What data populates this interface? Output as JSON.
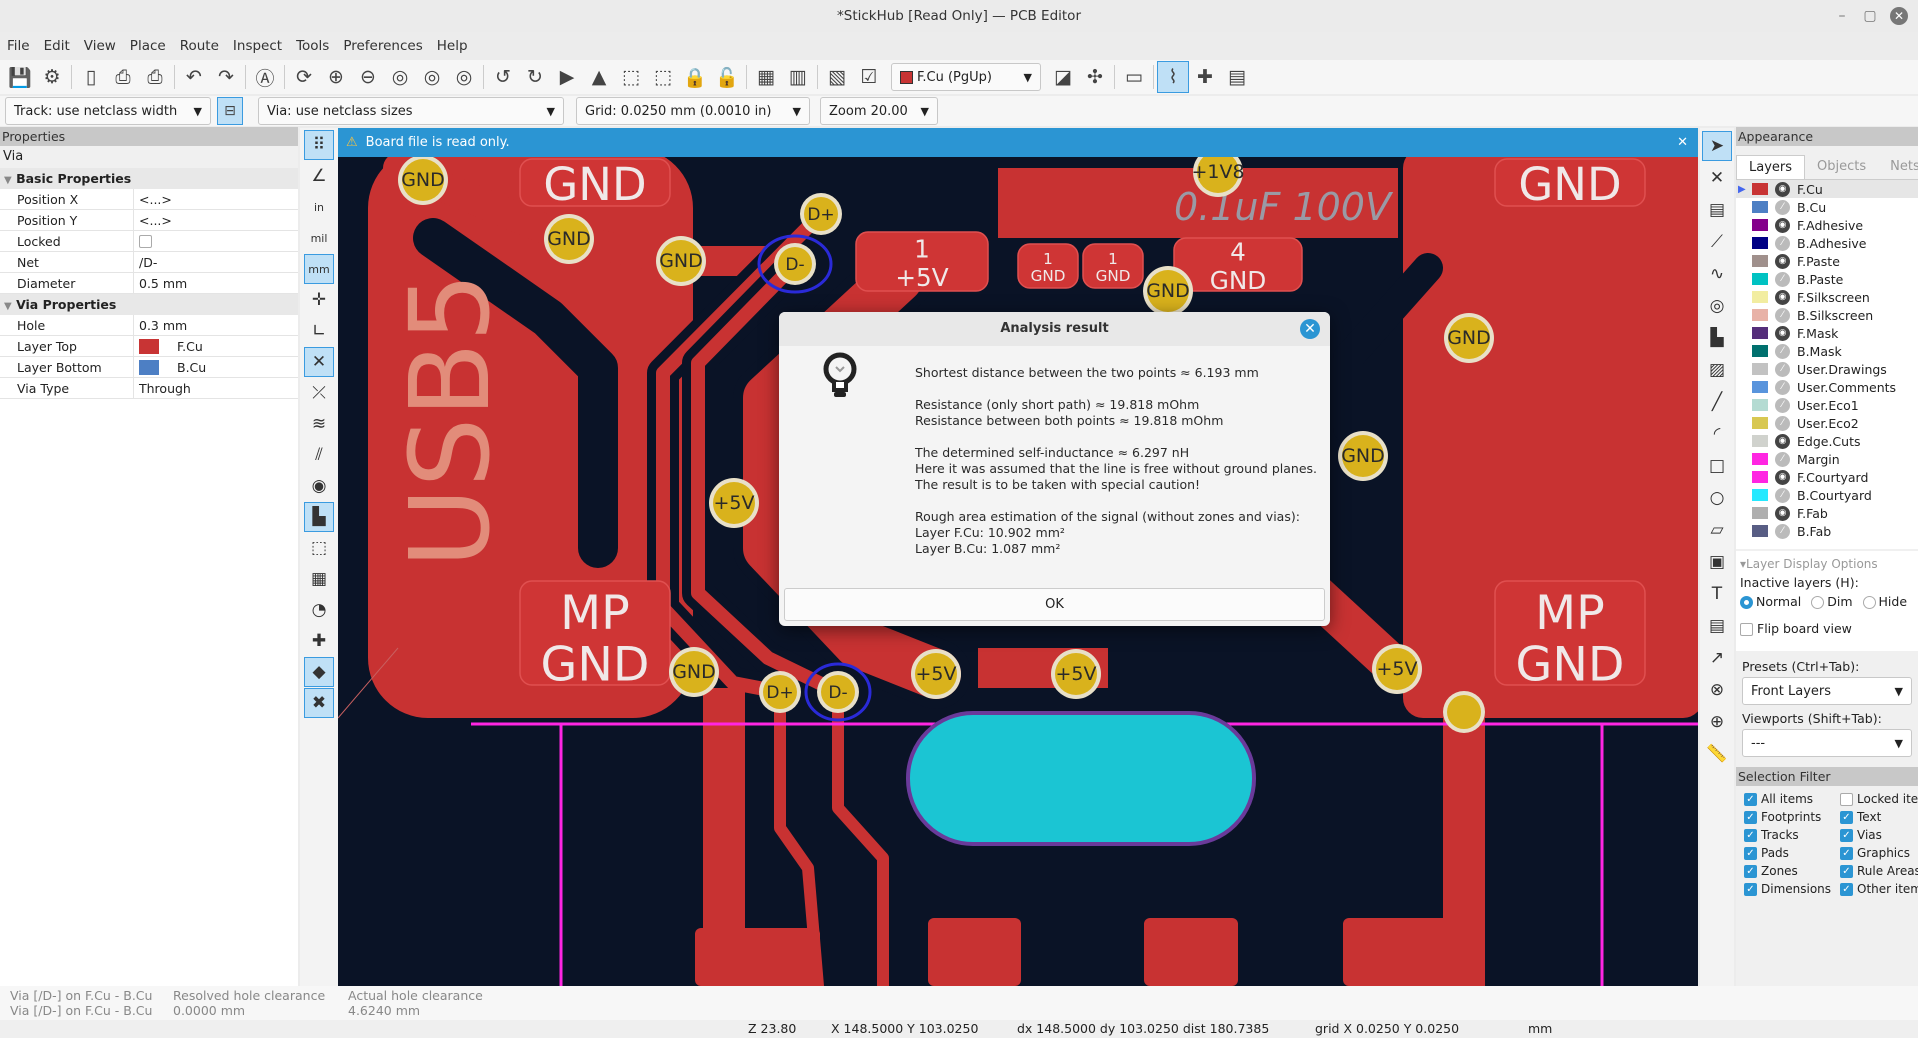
{
  "window": {
    "title": "*StickHub [Read Only] — PCB Editor"
  },
  "menu": [
    "File",
    "Edit",
    "View",
    "Place",
    "Route",
    "Inspect",
    "Tools",
    "Preferences",
    "Help"
  ],
  "toolbar": {
    "icons": [
      "save-icon",
      "board-setup-icon",
      "|",
      "page-settings-icon",
      "print-icon",
      "plot-icon",
      "|",
      "undo-icon",
      "redo-icon",
      "|",
      "find-icon",
      "|",
      "refresh-icon",
      "zoom-in-icon",
      "zoom-out-icon",
      "zoom-fit-icon",
      "zoom-objects-icon",
      "zoom-selection-icon",
      "|",
      "rotate-ccw-icon",
      "rotate-cw-icon",
      "mirror-h-icon",
      "mirror-v-icon",
      "group-icon",
      "ungroup-icon",
      "lock-icon",
      "unlock-icon",
      "|",
      "update-pcb-icon",
      "footprint-browser-icon",
      "|",
      "netlist-icon",
      "drc-icon"
    ],
    "layer_select": "F.Cu (PgUp)",
    "icons_right": [
      "layer-pair-icon",
      "net-inspector-icon",
      "|",
      "scripting-console-icon",
      "|",
      "calculator-icon",
      "add-footprint-icon",
      "layer-manager-icon"
    ],
    "track_width": "Track: use netclass width",
    "via_size": "Via: use netclass sizes",
    "grid": "Grid: 0.0250 mm (0.0010 in)",
    "zoom": "Zoom 20.00"
  },
  "infobar": {
    "message": "Board file is read only."
  },
  "properties": {
    "header": "Properties",
    "type": "Via",
    "basic_group": "Basic Properties",
    "basic": [
      {
        "key": "Position X",
        "value": "<...>"
      },
      {
        "key": "Position Y",
        "value": "<...>"
      },
      {
        "key": "Locked",
        "value": ""
      },
      {
        "key": "Net",
        "value": "/D-"
      },
      {
        "key": "Diameter",
        "value": "0.5 mm"
      }
    ],
    "via_group": "Via Properties",
    "via": [
      {
        "key": "Hole",
        "value": "0.3 mm"
      },
      {
        "key": "Layer Top",
        "value": "F.Cu",
        "color": "#c83434"
      },
      {
        "key": "Layer Bottom",
        "value": "B.Cu",
        "color": "#4d7fc4"
      },
      {
        "key": "Via Type",
        "value": "Through"
      }
    ]
  },
  "left_tools": [
    "grid-icon",
    "polar-coords-icon",
    "units-in-icon",
    "units-mil-icon",
    "units-mm-icon",
    "cursor-crosshair-icon",
    "angle-snap-icon",
    "ratsnest-icon",
    "curved-ratsnest-icon",
    "net-colors-icon",
    "track-outline-icon",
    "via-outline-icon",
    "zone-fill-icon",
    "zone-outline-icon",
    "pad-outline-icon",
    "microwave-icon",
    "highlight-net-icon",
    "layer-stack-icon",
    "properties-tools-icon"
  ],
  "right_tools": [
    "select-icon",
    "local-ratsnest-icon",
    "footprint-icon",
    "route-track-icon",
    "tune-length-icon",
    "via-icon",
    "add-zone-icon",
    "rule-area-icon",
    "line-icon",
    "arc-icon",
    "rectangle-icon",
    "circle-icon",
    "polygon-icon",
    "image-icon",
    "text-icon",
    "textbox-icon",
    "dimension-icon",
    "delete-icon",
    "anchor-icon",
    "measure-icon"
  ],
  "canvas": {
    "silk_text": "USB5",
    "comp_value": "0.1uF 100V",
    "pads": [
      {
        "line1": "",
        "line2": "GND"
      },
      {
        "line1": "",
        "line2": "GND"
      },
      {
        "line1": "MP",
        "line2": "GND"
      },
      {
        "line1": "MP",
        "line2": "GND"
      },
      {
        "line1": "1",
        "line2": "+5V"
      },
      {
        "line1": "1",
        "line2": "GND"
      },
      {
        "line1": "1",
        "line2": "GND"
      },
      {
        "line1": "4",
        "line2": "GND"
      }
    ],
    "vias": [
      "GND",
      "GND",
      "GND",
      "D+",
      "D-",
      "+1V8",
      "GND",
      "GND",
      "GND",
      "+5V",
      "GND",
      "D+",
      "D-",
      "+5V",
      "+5V",
      "+5V",
      ""
    ],
    "colors": {
      "copper": "#c83232",
      "background": "#0a1326",
      "via": "#d9b21c",
      "courtyard": "#ff26e2",
      "pad_cyan": "#1bc5d3"
    }
  },
  "dialog": {
    "title": "Analysis result",
    "lines": [
      [
        "Shortest distance between the two points ≈ 6.193 mm"
      ],
      [
        "Resistance (only short path) ≈ 19.818 mOhm",
        "Resistance between both points  ≈ 19.818 mOhm"
      ],
      [
        "The determined self-inductance ≈ 6.297 nH",
        "Here it was assumed that the line is free without ground planes.",
        "The result is to be taken with special caution!"
      ],
      [
        "Rough area estimation of the signal (without zones and vias):",
        "Layer F.Cu: 10.902 mm²",
        "Layer B.Cu: 1.087 mm²"
      ]
    ],
    "ok": "OK"
  },
  "appearance": {
    "header": "Appearance",
    "tabs": [
      "Layers",
      "Objects",
      "Nets"
    ],
    "layers": [
      {
        "name": "F.Cu",
        "color": "#c83434",
        "visible": true
      },
      {
        "name": "B.Cu",
        "color": "#4d7fc4",
        "visible": false
      },
      {
        "name": "F.Adhesive",
        "color": "#84008a",
        "visible": true
      },
      {
        "name": "B.Adhesive",
        "color": "#000084",
        "visible": false
      },
      {
        "name": "F.Paste",
        "color": "#a0908c",
        "visible": true
      },
      {
        "name": "B.Paste",
        "color": "#00c2c2",
        "visible": false
      },
      {
        "name": "F.Silkscreen",
        "color": "#f2eda1",
        "visible": true
      },
      {
        "name": "B.Silkscreen",
        "color": "#e8b2a7",
        "visible": false
      },
      {
        "name": "F.Mask",
        "color": "#552e7a",
        "visible": true
      },
      {
        "name": "B.Mask",
        "color": "#00706e",
        "visible": false
      },
      {
        "name": "User.Drawings",
        "color": "#c2c2c2",
        "visible": false
      },
      {
        "name": "User.Comments",
        "color": "#5994dc",
        "visible": false
      },
      {
        "name": "User.Eco1",
        "color": "#b4dbd2",
        "visible": false
      },
      {
        "name": "User.Eco2",
        "color": "#d8c852",
        "visible": false
      },
      {
        "name": "Edge.Cuts",
        "color": "#d0d2cd",
        "visible": true
      },
      {
        "name": "Margin",
        "color": "#ff26e2",
        "visible": false
      },
      {
        "name": "F.Courtyard",
        "color": "#ff26e2",
        "visible": true
      },
      {
        "name": "B.Courtyard",
        "color": "#26e9ff",
        "visible": false
      },
      {
        "name": "F.Fab",
        "color": "#afafaf",
        "visible": true
      },
      {
        "name": "B.Fab",
        "color": "#585d84",
        "visible": false
      }
    ],
    "display_options": "Layer Display Options",
    "inactive_label": "Inactive layers (H):",
    "inactive_options": [
      "Normal",
      "Dim",
      "Hide"
    ],
    "inactive_selected": "Normal",
    "flip_board": "Flip board view",
    "presets_label": "Presets (Ctrl+Tab):",
    "presets_value": "Front Layers",
    "viewports_label": "Viewports (Shift+Tab):",
    "viewports_value": "---",
    "selection_filter": "Selection Filter",
    "filters": [
      {
        "label": "All items",
        "checked": true
      },
      {
        "label": "Locked items",
        "checked": false
      },
      {
        "label": "Footprints",
        "checked": true
      },
      {
        "label": "Text",
        "checked": true
      },
      {
        "label": "Tracks",
        "checked": true
      },
      {
        "label": "Vias",
        "checked": true
      },
      {
        "label": "Pads",
        "checked": true
      },
      {
        "label": "Graphics",
        "checked": true
      },
      {
        "label": "Zones",
        "checked": true
      },
      {
        "label": "Rule Areas",
        "checked": true
      },
      {
        "label": "Dimensions",
        "checked": true
      },
      {
        "label": "Other items",
        "checked": true
      }
    ]
  },
  "messages": {
    "col1": [
      "Via [/D-] on F.Cu - B.Cu",
      "Via [/D-] on F.Cu - B.Cu"
    ],
    "col2": [
      "Resolved hole clearance",
      "0.0000 mm"
    ],
    "col3": [
      "Actual hole clearance",
      "4.6240 mm"
    ]
  },
  "status": {
    "zoom": "Z 23.80",
    "xy": "X 148.5000  Y 103.0250",
    "delta": "dx 148.5000  dy 103.0250  dist 180.7385",
    "grid": "grid X 0.0250  Y 0.0250",
    "units": "mm"
  }
}
